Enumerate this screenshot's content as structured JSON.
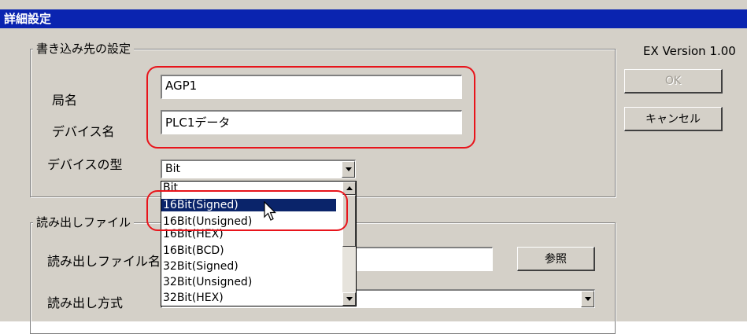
{
  "window": {
    "title": "詳細設定",
    "version": "EX Version 1.00"
  },
  "write_group": {
    "title": "書き込み先の設定",
    "station_label": "局名",
    "station_value": "AGP1",
    "device_label": "デバイス名",
    "device_value": "PLC1データ",
    "type_label": "デバイスの型",
    "type_value": "Bit"
  },
  "buttons": {
    "ok": "OK",
    "cancel": "キャンセル",
    "browse": "参照"
  },
  "read_group": {
    "title": "読み出しファイル",
    "file_label": "読み出しファイル名",
    "method_label": "読み出し方式"
  },
  "dropdown": {
    "items": [
      "Bit",
      "16Bit(Signed)",
      "16Bit(Unsigned)",
      "16Bit(HEX)",
      "16Bit(BCD)",
      "32Bit(Signed)",
      "32Bit(Unsigned)",
      "32Bit(HEX)"
    ],
    "selected": "16Bit(Signed)"
  },
  "colors": {
    "titlebar": "#0a24b0",
    "highlight": "#0a246a",
    "annotation": "#e8141b"
  }
}
